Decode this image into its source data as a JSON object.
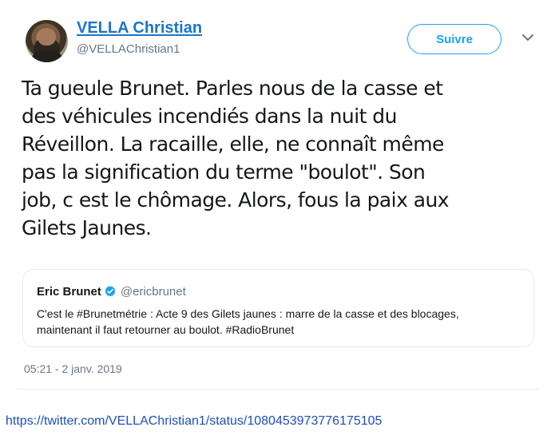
{
  "tweet": {
    "author_name": "VELLA Christian",
    "author_handle": "@VELLAChristian1",
    "follow_label": "Suivre",
    "text_lines": [
      "Ta gueule Brunet.  Parles nous de la casse et",
      "des véhicules incendiés dans la nuit du",
      "Réveillon.  La racaille, elle, ne connaît même",
      "pas la signification du terme \"boulot\". Son",
      "job, c est le chômage.  Alors, fous la paix aux",
      "Gilets Jaunes."
    ],
    "timestamp": "05:21 - 2 janv. 2019"
  },
  "quoted_tweet": {
    "author_name": "Eric Brunet",
    "author_handle": "@ericbrunet",
    "text_lines": [
      "C'est le #Brunetmétrie : Acte 9 des Gilets jaunes : marre de la casse et des blocages,",
      "maintenant il faut retourner au boulot. #RadioBrunet"
    ]
  },
  "source_url": "https://twitter.com/VELLAChristian1/status/1080453973776175105",
  "icons": {
    "avatar": "user-avatar-icon",
    "menu": "chevron-down-icon",
    "verified": "verified-badge-icon"
  },
  "colors": {
    "link_blue": "#1b75c9",
    "twitter_blue": "#1da1f2",
    "muted_gray": "#657786",
    "url_blue": "#1d4fb8"
  }
}
